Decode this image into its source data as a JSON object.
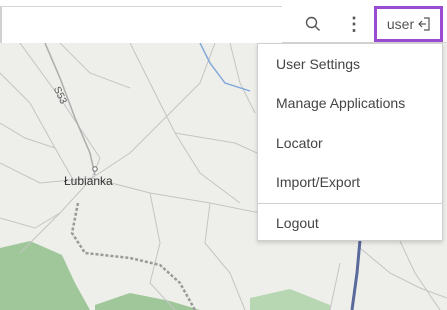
{
  "header": {
    "search_icon": "search-icon",
    "more_icon": "vertical-dots-icon",
    "more_glyph": "⋮",
    "user_label": "user",
    "user_icon": "logout-arrow-icon"
  },
  "map": {
    "road_label": "S53",
    "town_label": "Łubianka",
    "colors": {
      "background": "#eeeeea",
      "road": "#bfbfbf",
      "forest": "#9fc79a",
      "rail": "#9a9a9a",
      "river": "#7fa6d8",
      "highway": "#5a6a9c"
    }
  },
  "menu": {
    "items": [
      {
        "label": "User Settings"
      },
      {
        "label": "Manage Applications"
      },
      {
        "label": "Locator"
      },
      {
        "label": "Import/Export"
      },
      {
        "label": "Logout"
      }
    ]
  },
  "colors": {
    "highlight_border": "#9b4bd1"
  }
}
